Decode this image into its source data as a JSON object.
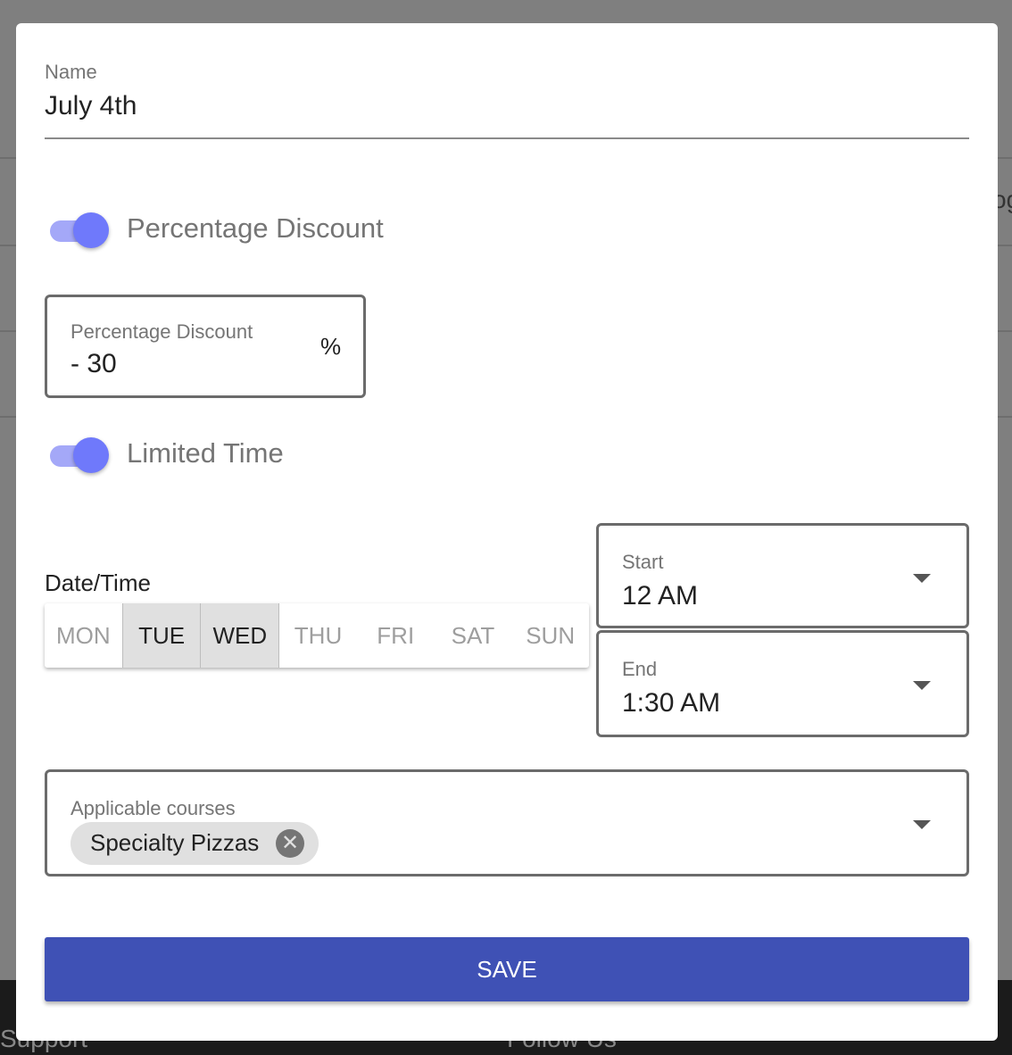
{
  "background": {
    "partial_text": "og",
    "footer": {
      "support": "Support",
      "follow": "Follow Us"
    }
  },
  "form": {
    "name": {
      "label": "Name",
      "value": "July 4th"
    },
    "percentage_toggle": {
      "label": "Percentage Discount",
      "on": true
    },
    "percentage_field": {
      "label": "Percentage Discount",
      "value": "- 30",
      "suffix": "%"
    },
    "limited_toggle": {
      "label": "Limited Time",
      "on": true
    },
    "datetime_label": "Date/Time",
    "days": [
      {
        "label": "MON",
        "selected": false
      },
      {
        "label": "TUE",
        "selected": true
      },
      {
        "label": "WED",
        "selected": true
      },
      {
        "label": "THU",
        "selected": false
      },
      {
        "label": "FRI",
        "selected": false
      },
      {
        "label": "SAT",
        "selected": false
      },
      {
        "label": "SUN",
        "selected": false
      }
    ],
    "start": {
      "label": "Start",
      "value": "12 AM"
    },
    "end": {
      "label": "End",
      "value": "1:30 AM"
    },
    "courses": {
      "label": "Applicable courses",
      "chips": [
        "Specialty Pizzas"
      ]
    },
    "save_label": "SAVE"
  },
  "colors": {
    "primary": "#3f51b5",
    "toggle": "#6f79fb"
  }
}
